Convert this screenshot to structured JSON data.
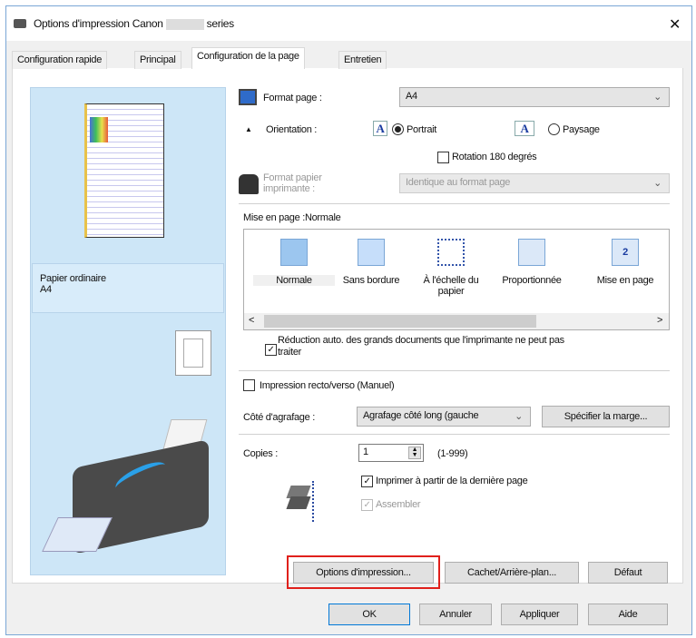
{
  "window": {
    "title_prefix": "Options d'impression Canon",
    "title_suffix": "series",
    "close": "✕"
  },
  "tabs": [
    "Configuration rapide",
    "Principal",
    "Configuration de la page",
    "Entretien"
  ],
  "preview": {
    "paper_type": "Papier ordinaire",
    "paper_size": "A4"
  },
  "format_page": {
    "label": "Format page :",
    "value": "A4"
  },
  "orientation": {
    "label": "Orientation :",
    "icon_letter": "A",
    "portrait": "Portrait",
    "landscape": "Paysage",
    "selected": "Portrait"
  },
  "rotation": {
    "label": "Rotation 180 degrés",
    "checked": false
  },
  "printer_paper": {
    "label_line1": "Format papier",
    "label_line2": "imprimante :",
    "value": "Identique au format page"
  },
  "layout": {
    "label": "Mise en page :Normale",
    "items": [
      {
        "label": "Normale",
        "label2": ""
      },
      {
        "label": "Sans bordure",
        "label2": ""
      },
      {
        "label": "À l'échelle du",
        "label2": "papier"
      },
      {
        "label": "Proportionnée",
        "label2": ""
      },
      {
        "label": "Mise en page",
        "label2": "",
        "badge": "2"
      }
    ],
    "scroll_left": "<",
    "scroll_right": ">"
  },
  "auto_reduce": {
    "label_line1": "Réduction auto. des grands documents que l'imprimante ne peut pas",
    "label_line2": "traiter",
    "checked": true
  },
  "duplex": {
    "label": "Impression recto/verso (Manuel)",
    "checked": false
  },
  "stapling": {
    "label": "Côté d'agrafage :",
    "value": "Agrafage côté long (gauche",
    "margin_button": "Spécifier la marge..."
  },
  "copies": {
    "label": "Copies :",
    "value": "1",
    "range": "(1-999)",
    "last_page": "Imprimer à partir de la dernière page",
    "collate": "Assembler"
  },
  "buttons": {
    "print_options": "Options d'impression...",
    "stamp": "Cachet/Arrière-plan...",
    "default": "Défaut",
    "ok": "OK",
    "cancel": "Annuler",
    "apply": "Appliquer",
    "help": "Aide"
  },
  "colors": {
    "highlight": "#e0201b",
    "preview_bg": "#cde6f7"
  }
}
